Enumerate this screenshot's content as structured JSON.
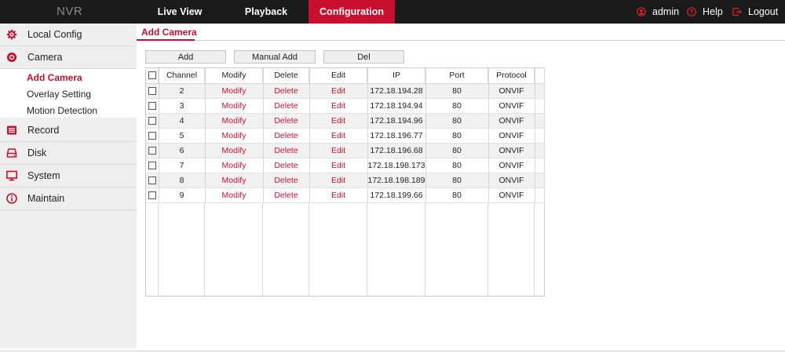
{
  "header": {
    "brand": "NVR",
    "tabs": [
      {
        "label": "Live View"
      },
      {
        "label": "Playback"
      },
      {
        "label": "Configuration"
      }
    ],
    "right": {
      "user": "admin",
      "help": "Help",
      "logout": "Logout"
    },
    "accent_color": "#c8102e"
  },
  "sidebar": {
    "items": [
      {
        "label": "Local Config",
        "icon": "gear-icon"
      },
      {
        "label": "Camera",
        "icon": "camera-icon"
      },
      {
        "label": "Record",
        "icon": "record-icon"
      },
      {
        "label": "Disk",
        "icon": "disk-icon"
      },
      {
        "label": "System",
        "icon": "monitor-icon"
      },
      {
        "label": "Maintain",
        "icon": "info-icon"
      }
    ],
    "camera_submenu": [
      {
        "label": "Add Camera"
      },
      {
        "label": "Overlay Setting"
      },
      {
        "label": "Motion Detection"
      }
    ]
  },
  "main": {
    "tab_label": "Add Camera",
    "buttons": {
      "add": "Add",
      "manual_add": "Manual Add",
      "del": "Del"
    },
    "table": {
      "headers": [
        "Channel",
        "Modify",
        "Delete",
        "Edit",
        "IP",
        "Port",
        "Protocol"
      ],
      "rows": [
        {
          "channel": "2",
          "modify": "Modify",
          "delete": "Delete",
          "edit": "Edit",
          "ip": "172.18.194.28",
          "port": "80",
          "protocol": "ONVIF"
        },
        {
          "channel": "3",
          "modify": "Modify",
          "delete": "Delete",
          "edit": "Edit",
          "ip": "172.18.194.94",
          "port": "80",
          "protocol": "ONVIF"
        },
        {
          "channel": "4",
          "modify": "Modify",
          "delete": "Delete",
          "edit": "Edit",
          "ip": "172.18.194.96",
          "port": "80",
          "protocol": "ONVIF"
        },
        {
          "channel": "5",
          "modify": "Modify",
          "delete": "Delete",
          "edit": "Edit",
          "ip": "172.18.196.77",
          "port": "80",
          "protocol": "ONVIF"
        },
        {
          "channel": "6",
          "modify": "Modify",
          "delete": "Delete",
          "edit": "Edit",
          "ip": "172.18.196.68",
          "port": "80",
          "protocol": "ONVIF"
        },
        {
          "channel": "7",
          "modify": "Modify",
          "delete": "Delete",
          "edit": "Edit",
          "ip": "172.18.198.173",
          "port": "80",
          "protocol": "ONVIF"
        },
        {
          "channel": "8",
          "modify": "Modify",
          "delete": "Delete",
          "edit": "Edit",
          "ip": "172.18.198.189",
          "port": "80",
          "protocol": "ONVIF"
        },
        {
          "channel": "9",
          "modify": "Modify",
          "delete": "Delete",
          "edit": "Edit",
          "ip": "172.18.199.66",
          "port": "80",
          "protocol": "ONVIF"
        }
      ]
    }
  }
}
